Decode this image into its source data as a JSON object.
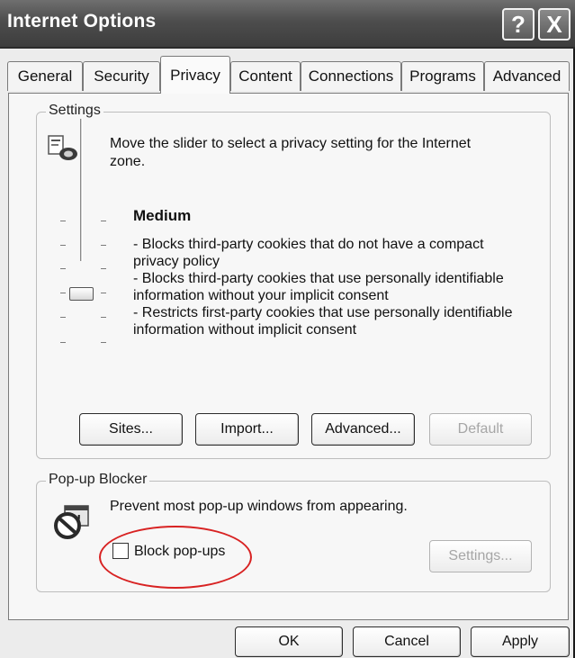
{
  "window": {
    "title": "Internet Options",
    "help_symbol": "?",
    "close_symbol": "X"
  },
  "tabs": [
    {
      "label": "General"
    },
    {
      "label": "Security"
    },
    {
      "label": "Privacy",
      "active": true
    },
    {
      "label": "Content"
    },
    {
      "label": "Connections"
    },
    {
      "label": "Programs"
    },
    {
      "label": "Advanced"
    }
  ],
  "settings": {
    "group_label": "Settings",
    "instruction": [
      "Move the slider to select a privacy setting for the Internet",
      "zone."
    ],
    "slider": {
      "level": "Medium",
      "position": 3,
      "positions_total": 6
    },
    "level_title": "Medium",
    "description_lines": [
      "- Blocks third-party cookies that do not have a compact",
      "privacy policy",
      "- Blocks third-party cookies that use personally identifiable",
      "information without your implicit consent",
      "- Restricts first-party cookies that use personally identifiable",
      "information without implicit consent"
    ],
    "buttons": {
      "sites": "Sites...",
      "import": "Import...",
      "advanced": "Advanced...",
      "default": "Default"
    }
  },
  "popup_blocker": {
    "group_label": "Pop-up Blocker",
    "description": "Prevent most pop-up windows from appearing.",
    "checkbox_label": "Block pop-ups",
    "checked": false,
    "settings_button": "Settings..."
  },
  "footer": {
    "ok": "OK",
    "cancel": "Cancel",
    "apply": "Apply"
  },
  "colors": {
    "highlight": "#d82222"
  }
}
